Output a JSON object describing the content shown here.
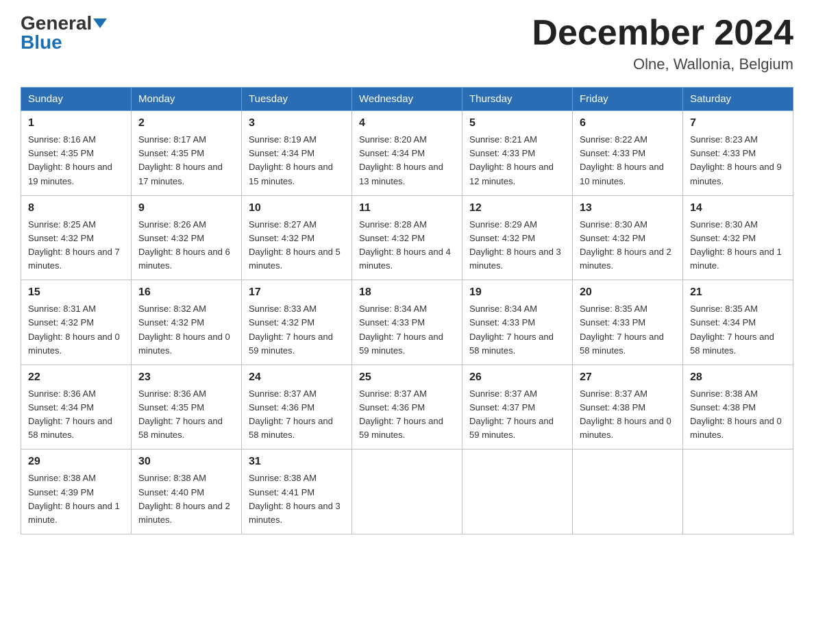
{
  "logo": {
    "general": "General",
    "blue": "Blue"
  },
  "header": {
    "month": "December 2024",
    "location": "Olne, Wallonia, Belgium"
  },
  "weekdays": [
    "Sunday",
    "Monday",
    "Tuesday",
    "Wednesday",
    "Thursday",
    "Friday",
    "Saturday"
  ],
  "weeks": [
    [
      {
        "day": "1",
        "sunrise": "8:16 AM",
        "sunset": "4:35 PM",
        "daylight": "8 hours and 19 minutes."
      },
      {
        "day": "2",
        "sunrise": "8:17 AM",
        "sunset": "4:35 PM",
        "daylight": "8 hours and 17 minutes."
      },
      {
        "day": "3",
        "sunrise": "8:19 AM",
        "sunset": "4:34 PM",
        "daylight": "8 hours and 15 minutes."
      },
      {
        "day": "4",
        "sunrise": "8:20 AM",
        "sunset": "4:34 PM",
        "daylight": "8 hours and 13 minutes."
      },
      {
        "day": "5",
        "sunrise": "8:21 AM",
        "sunset": "4:33 PM",
        "daylight": "8 hours and 12 minutes."
      },
      {
        "day": "6",
        "sunrise": "8:22 AM",
        "sunset": "4:33 PM",
        "daylight": "8 hours and 10 minutes."
      },
      {
        "day": "7",
        "sunrise": "8:23 AM",
        "sunset": "4:33 PM",
        "daylight": "8 hours and 9 minutes."
      }
    ],
    [
      {
        "day": "8",
        "sunrise": "8:25 AM",
        "sunset": "4:32 PM",
        "daylight": "8 hours and 7 minutes."
      },
      {
        "day": "9",
        "sunrise": "8:26 AM",
        "sunset": "4:32 PM",
        "daylight": "8 hours and 6 minutes."
      },
      {
        "day": "10",
        "sunrise": "8:27 AM",
        "sunset": "4:32 PM",
        "daylight": "8 hours and 5 minutes."
      },
      {
        "day": "11",
        "sunrise": "8:28 AM",
        "sunset": "4:32 PM",
        "daylight": "8 hours and 4 minutes."
      },
      {
        "day": "12",
        "sunrise": "8:29 AM",
        "sunset": "4:32 PM",
        "daylight": "8 hours and 3 minutes."
      },
      {
        "day": "13",
        "sunrise": "8:30 AM",
        "sunset": "4:32 PM",
        "daylight": "8 hours and 2 minutes."
      },
      {
        "day": "14",
        "sunrise": "8:30 AM",
        "sunset": "4:32 PM",
        "daylight": "8 hours and 1 minute."
      }
    ],
    [
      {
        "day": "15",
        "sunrise": "8:31 AM",
        "sunset": "4:32 PM",
        "daylight": "8 hours and 0 minutes."
      },
      {
        "day": "16",
        "sunrise": "8:32 AM",
        "sunset": "4:32 PM",
        "daylight": "8 hours and 0 minutes."
      },
      {
        "day": "17",
        "sunrise": "8:33 AM",
        "sunset": "4:32 PM",
        "daylight": "7 hours and 59 minutes."
      },
      {
        "day": "18",
        "sunrise": "8:34 AM",
        "sunset": "4:33 PM",
        "daylight": "7 hours and 59 minutes."
      },
      {
        "day": "19",
        "sunrise": "8:34 AM",
        "sunset": "4:33 PM",
        "daylight": "7 hours and 58 minutes."
      },
      {
        "day": "20",
        "sunrise": "8:35 AM",
        "sunset": "4:33 PM",
        "daylight": "7 hours and 58 minutes."
      },
      {
        "day": "21",
        "sunrise": "8:35 AM",
        "sunset": "4:34 PM",
        "daylight": "7 hours and 58 minutes."
      }
    ],
    [
      {
        "day": "22",
        "sunrise": "8:36 AM",
        "sunset": "4:34 PM",
        "daylight": "7 hours and 58 minutes."
      },
      {
        "day": "23",
        "sunrise": "8:36 AM",
        "sunset": "4:35 PM",
        "daylight": "7 hours and 58 minutes."
      },
      {
        "day": "24",
        "sunrise": "8:37 AM",
        "sunset": "4:36 PM",
        "daylight": "7 hours and 58 minutes."
      },
      {
        "day": "25",
        "sunrise": "8:37 AM",
        "sunset": "4:36 PM",
        "daylight": "7 hours and 59 minutes."
      },
      {
        "day": "26",
        "sunrise": "8:37 AM",
        "sunset": "4:37 PM",
        "daylight": "7 hours and 59 minutes."
      },
      {
        "day": "27",
        "sunrise": "8:37 AM",
        "sunset": "4:38 PM",
        "daylight": "8 hours and 0 minutes."
      },
      {
        "day": "28",
        "sunrise": "8:38 AM",
        "sunset": "4:38 PM",
        "daylight": "8 hours and 0 minutes."
      }
    ],
    [
      {
        "day": "29",
        "sunrise": "8:38 AM",
        "sunset": "4:39 PM",
        "daylight": "8 hours and 1 minute."
      },
      {
        "day": "30",
        "sunrise": "8:38 AM",
        "sunset": "4:40 PM",
        "daylight": "8 hours and 2 minutes."
      },
      {
        "day": "31",
        "sunrise": "8:38 AM",
        "sunset": "4:41 PM",
        "daylight": "8 hours and 3 minutes."
      },
      null,
      null,
      null,
      null
    ]
  ]
}
